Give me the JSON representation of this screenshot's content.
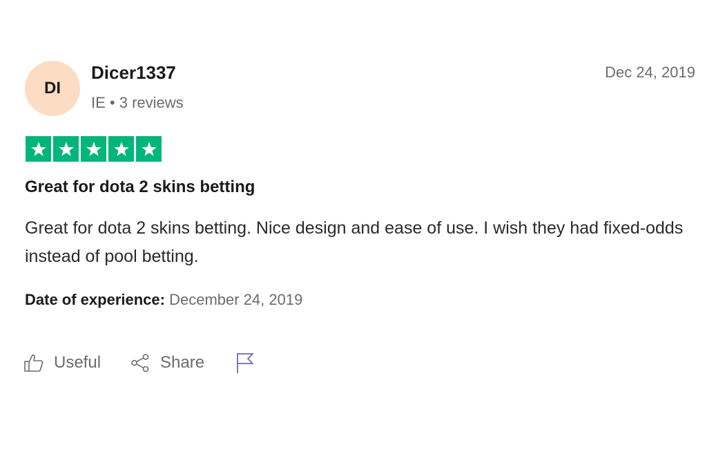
{
  "reviewer": {
    "initials": "DI",
    "name": "Dicer1337",
    "country": "IE",
    "separator": "•",
    "review_count": "3 reviews"
  },
  "review": {
    "date": "Dec 24, 2019",
    "rating": 5,
    "rating_max": 5,
    "title": "Great for dota 2 skins betting",
    "body": "Great for dota 2 skins betting. Nice design and ease of use. I wish they had fixed-odds instead of pool betting.",
    "experience_label": "Date of experience:",
    "experience_date": "December 24, 2019"
  },
  "actions": {
    "useful_label": "Useful",
    "share_label": "Share",
    "useful_icon": "thumbs-up-icon",
    "share_icon": "share-icon",
    "report_icon": "flag-icon"
  },
  "colors": {
    "star_fill": "#00b67a",
    "avatar_bg": "#fcdcc2",
    "flag_color": "#6c6bb3",
    "muted_text": "#6b6b6b"
  }
}
